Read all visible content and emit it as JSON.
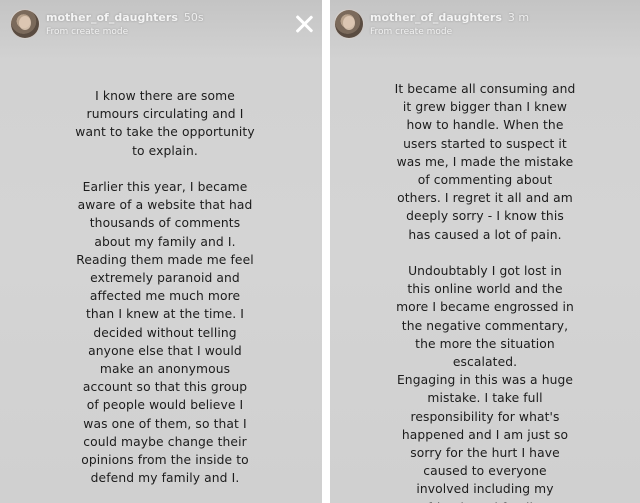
{
  "stories": [
    {
      "username": "mother_of_daughters",
      "time": "50s",
      "subtitle": "From create mode",
      "icon": "avatar",
      "close_icon": "close-icon",
      "text": "I know there are some\nrumours circulating and I\nwant to take the opportunity\nto explain.\n\nEarlier this year, I became\naware of a website that had\nthousands of comments\nabout my family and I.\nReading them made me feel\nextremely paranoid and\naffected me much more\nthan I knew at the time. I\ndecided without telling\nanyone else that I would\nmake an anonymous\naccount so that this group\nof people would believe I\nwas one of them, so that I\ncould maybe change their\nopinions from the inside to\ndefend my family and I."
    },
    {
      "username": "mother_of_daughters",
      "time": "3 m",
      "subtitle": "From create mode",
      "icon": "avatar",
      "text": "It became all consuming and\nit grew bigger than I knew\nhow to handle. When the\nusers started to suspect it\nwas me, I made the mistake\nof commenting about\nothers. I regret it all and am\ndeeply sorry - I know this\nhas caused a lot of pain.\n\nUndoubtably I got lost in\nthis online world and the\nmore I became engrossed in\nthe negative commentary,\nthe more the situation\nescalated.\nEngaging in this was a huge\nmistake. I take full\nresponsibility for what's\nhappened and I am just so\nsorry for the hurt I have\ncaused to everyone\ninvolved including my\nfriends and family."
    }
  ]
}
